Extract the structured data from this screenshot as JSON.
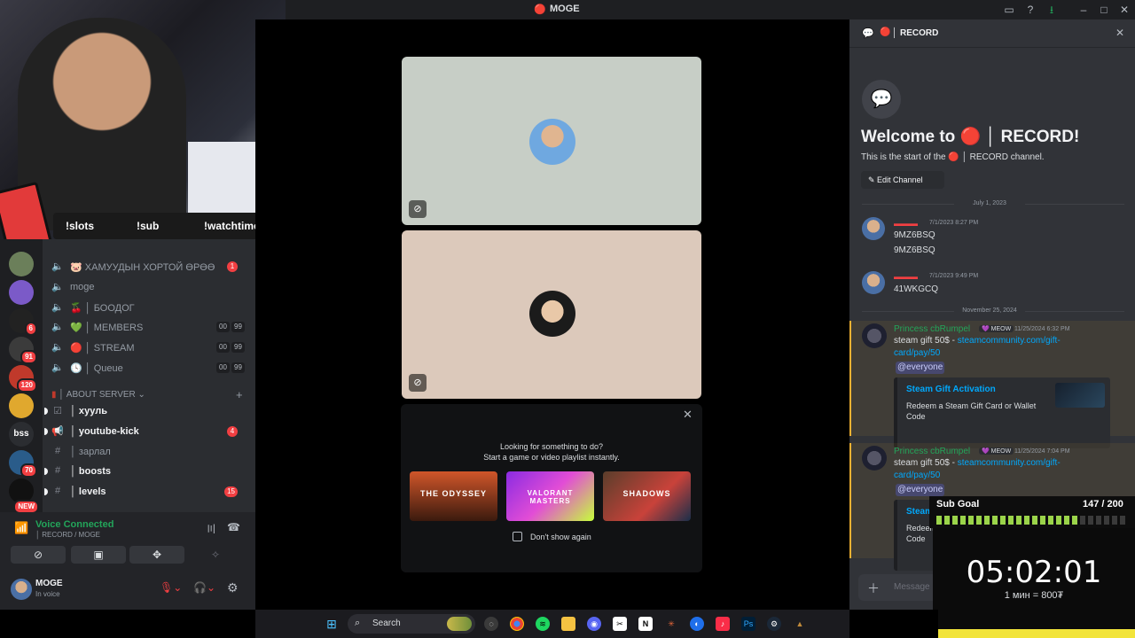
{
  "window": {
    "title": "MOGE"
  },
  "stream_overlay": {
    "commands": [
      "!slots",
      "!sub",
      "!watchtime"
    ],
    "sub_goal": {
      "label": "Sub Goal",
      "current": 147,
      "target": 200,
      "text": "147 / 200",
      "progress": 0.735
    },
    "timer": {
      "time": "05:02:01",
      "rate": "1 мин = 800₮"
    }
  },
  "rail": {
    "servers": [
      {
        "name": "server-1",
        "badge": ""
      },
      {
        "name": "server-2",
        "badge": ""
      },
      {
        "name": "server-3",
        "badge": "6"
      },
      {
        "name": "server-4",
        "badge": "91"
      },
      {
        "name": "server-5",
        "badge": "120"
      },
      {
        "name": "server-6",
        "badge": ""
      },
      {
        "name": "bss",
        "badge": ""
      },
      {
        "name": "server-8",
        "badge": "70"
      },
      {
        "name": "server-9",
        "badge": "NEW"
      }
    ],
    "bss_label": "bss"
  },
  "sidebar": {
    "voice_channels": [
      {
        "label": "ХАМУУДЫН ХОРТОЙ ӨРӨӨ",
        "emoji": "🐷",
        "badge": "1",
        "limit": []
      },
      {
        "label": "moge",
        "emoji": "",
        "badge": "",
        "limit": []
      },
      {
        "label": "│ БООДОГ",
        "emoji": "🍒",
        "badge": "",
        "limit": []
      },
      {
        "label": "│ MEMBERS",
        "emoji": "💚",
        "badge": "",
        "limit": [
          "00",
          "99"
        ]
      },
      {
        "label": "│ STREAM",
        "emoji": "🔴",
        "badge": "",
        "limit": [
          "00",
          "99"
        ]
      },
      {
        "label": "│ Queue",
        "emoji": "🕓",
        "badge": "",
        "limit": [
          "00",
          "99"
        ]
      }
    ],
    "category": "│ ABOUT SERVER",
    "text_channels": [
      {
        "label": "│ хууль",
        "unread": true,
        "badge": ""
      },
      {
        "label": "│ youtube-kick",
        "unread": true,
        "badge": "4"
      },
      {
        "label": "│ зарлал",
        "unread": false,
        "badge": ""
      },
      {
        "label": "│ boosts",
        "unread": true,
        "badge": ""
      },
      {
        "label": "│ levels",
        "unread": true,
        "badge": "15"
      }
    ]
  },
  "voice_panel": {
    "status": "Voice Connected",
    "location": "│ RECORD / MOGE",
    "user": {
      "name": "MOGE",
      "status": "In voice"
    }
  },
  "activity": {
    "prompt_line1": "Looking for something to do?",
    "prompt_line2": "Start a game or video playlist instantly.",
    "games": [
      "THE ODYSSEY",
      "VALORANT MASTERS",
      "SHADOWS"
    ],
    "checkbox_label": "Don't show again"
  },
  "chat": {
    "channel": "│ RECORD",
    "welcome_title": "Welcome to",
    "welcome_channel": "│ RECORD!",
    "intro_prefix": "This is the start of the",
    "intro_suffix": "│ RECORD channel.",
    "edit_channel": "Edit Channel",
    "date1": "July 1, 2023",
    "date2": "November 25, 2024",
    "messages": [
      {
        "time": "7/1/2023 8:27 PM",
        "lines": [
          "9MZ6BSQ",
          "9MZ6BSQ"
        ]
      },
      {
        "time": "7/1/2023 9:49 PM",
        "lines": [
          "41WKGCQ"
        ]
      }
    ],
    "gift_messages": [
      {
        "author": "Princess cbRumpel",
        "tag": "MEOW",
        "time": "11/25/2024 6:32 PM",
        "text": "steam gift 50$ - ",
        "link": "steamcommunity.com/gift-card/pay/50",
        "mention": "@everyone",
        "embed_title": "Steam Gift Activation",
        "embed_desc": "Redeem a Steam Gift Card or Wallet Code"
      },
      {
        "author": "Princess cbRumpel",
        "tag": "MEOW",
        "time": "11/25/2024 7:04 PM",
        "text": "steam gift 50$ - ",
        "link": "steamcommunity.com/gift-card/pay/50",
        "mention": "@everyone",
        "embed_title": "Steam Gift Activation",
        "embed_desc": "Redeem a Steam Gift Card or Wallet Code"
      }
    ],
    "input_placeholder": "Message"
  },
  "taskbar": {
    "search_label": "Search"
  },
  "colors": {
    "accent": "#5865f2",
    "voice_green": "#23a55a",
    "danger": "#f23f42",
    "link": "#00a8fc",
    "subgoal_fill": "#9bd44a"
  }
}
